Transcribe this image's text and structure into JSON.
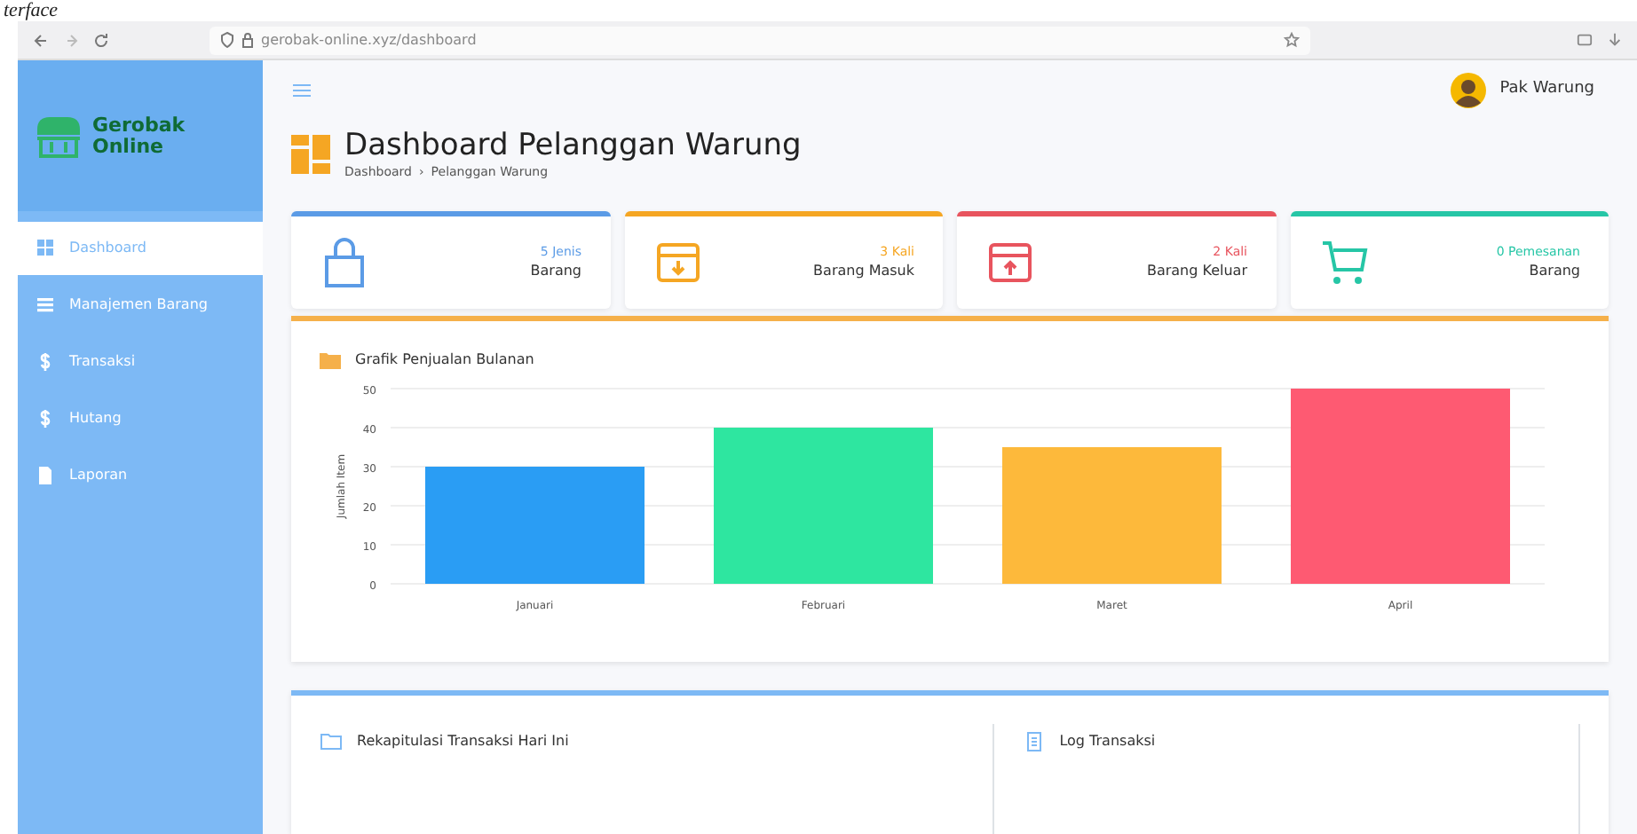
{
  "caption": "terface",
  "browser": {
    "url": "gerobak-online.xyz/dashboard"
  },
  "sidebar": {
    "brand": [
      "Gerobak",
      "Online"
    ],
    "items": [
      {
        "label": "Dashboard",
        "selected": true
      },
      {
        "label": "Manajemen Barang",
        "selected": false
      },
      {
        "label": "Transaksi",
        "selected": false
      },
      {
        "label": "Hutang",
        "selected": false
      },
      {
        "label": "Laporan",
        "selected": false
      }
    ]
  },
  "header": {
    "user": "Pak Warung"
  },
  "page": {
    "title": "Dashboard Pelanggan Warung",
    "breadcrumb": [
      "Dashboard",
      "Pelanggan Warung"
    ],
    "breadcrumb_separator": "›"
  },
  "stats": [
    {
      "value": "5 Jenis",
      "label": "Barang",
      "color": "#5b9be6"
    },
    {
      "value": "3 Kali",
      "label": "Barang Masuk",
      "color": "#f5a623"
    },
    {
      "value": "2 Kali",
      "label": "Barang Keluar",
      "color": "#e8545e"
    },
    {
      "value": "0 Pemesanan",
      "label": "Barang",
      "color": "#26c6a6"
    }
  ],
  "sales_chart": {
    "title": "Grafik Penjualan Bulanan",
    "chart_data": {
      "type": "bar",
      "ylabel": "Jumlah Item",
      "categories": [
        "Januari",
        "Februari",
        "Maret",
        "April"
      ],
      "values": [
        30,
        40,
        35,
        50
      ],
      "ylim": [
        0,
        50
      ],
      "yticks": [
        0,
        10,
        20,
        30,
        40,
        50
      ],
      "grid": true
    }
  },
  "bottom": {
    "panels": [
      {
        "title": "Rekapitulasi Transaksi Hari Ini"
      },
      {
        "title": "Log Transaksi"
      }
    ]
  }
}
